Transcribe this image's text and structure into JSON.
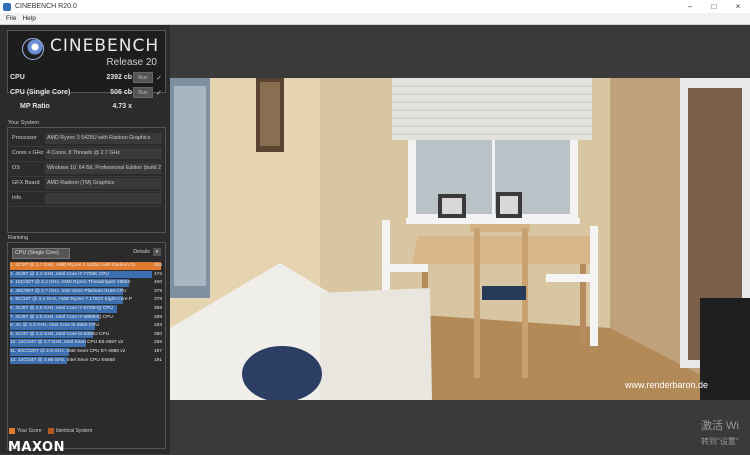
{
  "window": {
    "title": "CINEBENCH R20.0",
    "minimize": "–",
    "maximize": "□",
    "close": "×"
  },
  "menu": {
    "file": "File",
    "help": "Help"
  },
  "logo": {
    "name": "CINEBENCH",
    "release": "Release 20"
  },
  "scores": {
    "cpu": {
      "label": "CPU",
      "value": "2392 cb",
      "run": "Run"
    },
    "single": {
      "label": "CPU (Single Core)",
      "value": "506 cb",
      "run": "Run"
    },
    "ratio": {
      "label": "MP Ratio",
      "value": "4.73 x"
    }
  },
  "your_system": {
    "title": "Your System",
    "rows": [
      {
        "label": "Processor",
        "value": "AMD Ryzen 3 5425U with Radeon Graphics"
      },
      {
        "label": "Cores x GHz",
        "value": "4 Cores, 8 Threads @ 2.7 GHz"
      },
      {
        "label": "OS",
        "value": "Windows 10, 64 Bit, Professional Edition (build 2"
      },
      {
        "label": "GFX Board",
        "value": "AMD Radeon (TM) Graphics"
      },
      {
        "label": "Info",
        "value": ""
      }
    ]
  },
  "ranking": {
    "title": "Ranking",
    "selector": "CPU (Single Core)",
    "details": "Details",
    "rows": [
      {
        "text": "1. 4C/8T @ 2.7 GHz, AMD Ryzen 3 5425U with Radeon Gr",
        "score": "506",
        "fraction": 1.0,
        "color": "#e07a2e"
      },
      {
        "text": "2. 4C/8T @ 4.2 GHz, Intel Core i7-7700K CPU",
        "score": "476",
        "fraction": 0.94,
        "color": "#3c6fb0"
      },
      {
        "text": "3. 16C/32T @ 3.4 GHz, AMD Ryzen Threadripper 1950X",
        "score": "400",
        "fraction": 0.79,
        "color": "#3c6fb0"
      },
      {
        "text": "4. 48C/96T @ 2.7 GHz, Intel Xeon Platinum 8168 CPU",
        "score": "379",
        "fraction": 0.75,
        "color": "#3c6fb0"
      },
      {
        "text": "5. 8C/16T @ 3.4 GHz, AMD Ryzen 7 1700X Eight-Core P",
        "score": "378",
        "fraction": 0.75,
        "color": "#3c6fb0"
      },
      {
        "text": "6. 4C/8T @ 2.6 GHz, Intel Core i7-6700HQ CPU",
        "score": "359",
        "fraction": 0.71,
        "color": "#3c6fb0"
      },
      {
        "text": "7. 4C/8T @ 2.5 GHz, Intel Core i7-4850HQ CPU",
        "score": "298",
        "fraction": 0.59,
        "color": "#3c6fb0"
      },
      {
        "text": "8. 4C @ 3.3 GHz, Intel Core i5-3550 CPU",
        "score": "283",
        "fraction": 0.56,
        "color": "#3c6fb0"
      },
      {
        "text": "9. 2C/4T @ 2.3 GHz, Intel Core i5-5300U CPU",
        "score": "280",
        "fraction": 0.55,
        "color": "#3c6fb0"
      },
      {
        "text": "10. 12C/24T @ 2.7 GHz, Intel Xeon CPU E5-2697 v2",
        "score": "255",
        "fraction": 0.5,
        "color": "#3c6fb0"
      },
      {
        "text": "11. 60C/120T @ 2.8 GHz, Intel Xeon CPU E7-4890 v2",
        "score": "197",
        "fraction": 0.39,
        "color": "#3c6fb0"
      },
      {
        "text": "12. 12C/24T @ 2.66 GHz, Intel Xeon CPU X5650",
        "score": "191",
        "fraction": 0.38,
        "color": "#3c6fb0"
      }
    ]
  },
  "legend": {
    "your_score": "Your Score",
    "identical": "Identical System",
    "your_color": "#e07a2e",
    "identical_color": "#b85a20"
  },
  "brand": "MAXON",
  "watermark": "www.renderbaron.de",
  "activation": {
    "line1": "激活 Wi",
    "line2": "转到\"设置\""
  }
}
